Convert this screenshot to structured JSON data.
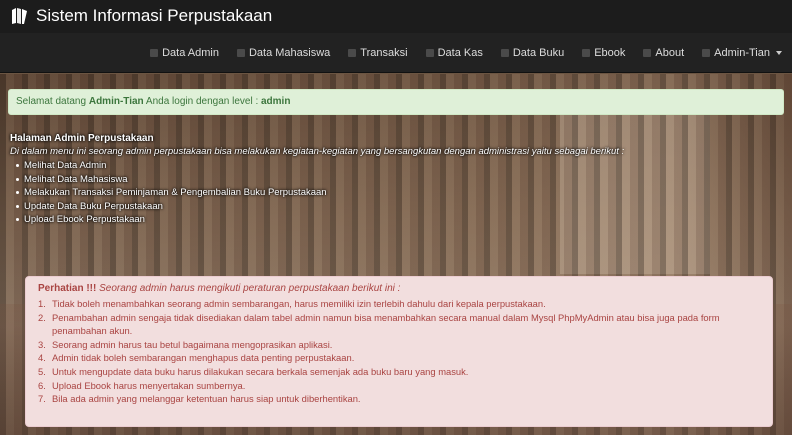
{
  "app": {
    "title": "Sistem Informasi Perpustakaan",
    "nav": [
      {
        "label": "Data Admin",
        "icon": "user-icon"
      },
      {
        "label": "Data Mahasiswa",
        "icon": "list-icon"
      },
      {
        "label": "Transaksi",
        "icon": "list-icon"
      },
      {
        "label": "Data Kas",
        "icon": "book-icon"
      },
      {
        "label": "Data Buku",
        "icon": "list-icon"
      },
      {
        "label": "Ebook",
        "icon": "list-icon"
      },
      {
        "label": "About",
        "icon": "list-icon"
      },
      {
        "label": "Admin-Tian",
        "icon": "user-icon"
      }
    ]
  },
  "welcome": {
    "prefix": "Selamat datang",
    "user": "Admin-Tian",
    "middle": "Anda login dengan level :",
    "level": "admin"
  },
  "intro": {
    "title": "Halaman Admin Perpustakaan",
    "description": "Di dalam menu ini seorang admin perpustakaan bisa melakukan kegiatan-kegiatan yang bersangkutan dengan administrasi yaitu sebagai berikut :",
    "items": [
      "Melihat Data Admin",
      "Melihat Data Mahasiswa",
      "Melakukan Transaksi Peminjaman & Pengembalian Buku Perpustakaan",
      "Update Data Buku Perpustakaan",
      "Upload Ebook Perpustakaan"
    ]
  },
  "warning": {
    "title": "Perhatian !!!",
    "subtitle": "Seorang admin harus mengikuti peraturan perpustakaan berikut ini :",
    "rules": [
      {
        "num": "1.",
        "text": "Tidak boleh menambahkan seorang admin sembarangan, harus memiliki izin terlebih dahulu dari kepala perpustakaan."
      },
      {
        "num": "2.",
        "text": "Penambahan admin sengaja tidak disediakan dalam tabel admin namun bisa menambahkan secara manual dalam Mysql PhpMyAdmin atau bisa juga pada form penambahan akun."
      },
      {
        "num": "3.",
        "text": "Seorang admin harus tau betul bagaimana mengoprasikan aplikasi."
      },
      {
        "num": "4.",
        "text": "Admin tidak boleh sembarangan menghapus data penting perpustakaan."
      },
      {
        "num": "5.",
        "text": "Untuk mengupdate data buku harus dilakukan secara berkala semenjak ada buku baru yang masuk."
      },
      {
        "num": "6.",
        "text": "Upload Ebook harus menyertakan sumbernya."
      },
      {
        "num": "7.",
        "text": "Bila ada admin yang melanggar ketentuan harus siap untuk diberhentikan."
      }
    ]
  }
}
